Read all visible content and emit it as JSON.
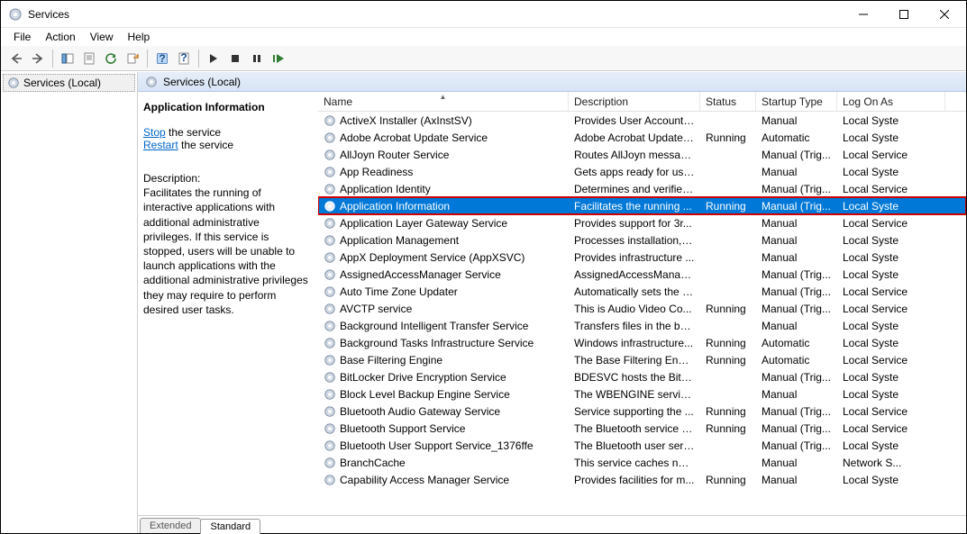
{
  "window": {
    "title": "Services"
  },
  "menu": {
    "file": "File",
    "action": "Action",
    "view": "View",
    "help": "Help"
  },
  "tree": {
    "root": "Services (Local)"
  },
  "panel_header": "Services (Local)",
  "detail": {
    "title": "Application Information",
    "stop_link": "Stop",
    "stop_tail": " the service",
    "restart_link": "Restart",
    "restart_tail": " the service",
    "desc_label": "Description:",
    "desc_body": "Facilitates the running of interactive applications with additional administrative privileges.  If this service is stopped, users will be unable to launch applications with the additional administrative privileges they may require to perform desired user tasks."
  },
  "columns": {
    "name": "Name",
    "desc": "Description",
    "status": "Status",
    "startup": "Startup Type",
    "logon": "Log On As"
  },
  "tabs": {
    "extended": "Extended",
    "standard": "Standard"
  },
  "services": [
    {
      "name": "ActiveX Installer (AxInstSV)",
      "desc": "Provides User Account ...",
      "status": "",
      "startup": "Manual",
      "logon": "Local Syste"
    },
    {
      "name": "Adobe Acrobat Update Service",
      "desc": "Adobe Acrobat Updater...",
      "status": "Running",
      "startup": "Automatic",
      "logon": "Local Syste"
    },
    {
      "name": "AllJoyn Router Service",
      "desc": "Routes AllJoyn messag...",
      "status": "",
      "startup": "Manual (Trig...",
      "logon": "Local Service"
    },
    {
      "name": "App Readiness",
      "desc": "Gets apps ready for use ...",
      "status": "",
      "startup": "Manual",
      "logon": "Local Syste"
    },
    {
      "name": "Application Identity",
      "desc": "Determines and verifies...",
      "status": "",
      "startup": "Manual (Trig...",
      "logon": "Local Service"
    },
    {
      "name": "Application Information",
      "desc": "Facilitates the running ...",
      "status": "Running",
      "startup": "Manual (Trig...",
      "logon": "Local Syste",
      "selected": true
    },
    {
      "name": "Application Layer Gateway Service",
      "desc": "Provides support for 3r...",
      "status": "",
      "startup": "Manual",
      "logon": "Local Service"
    },
    {
      "name": "Application Management",
      "desc": "Processes installation, r...",
      "status": "",
      "startup": "Manual",
      "logon": "Local Syste"
    },
    {
      "name": "AppX Deployment Service (AppXSVC)",
      "desc": "Provides infrastructure ...",
      "status": "",
      "startup": "Manual",
      "logon": "Local Syste"
    },
    {
      "name": "AssignedAccessManager Service",
      "desc": "AssignedAccessManag...",
      "status": "",
      "startup": "Manual (Trig...",
      "logon": "Local Syste"
    },
    {
      "name": "Auto Time Zone Updater",
      "desc": "Automatically sets the s...",
      "status": "",
      "startup": "Manual (Trig...",
      "logon": "Local Service"
    },
    {
      "name": "AVCTP service",
      "desc": "This is Audio Video Co...",
      "status": "Running",
      "startup": "Manual (Trig...",
      "logon": "Local Service"
    },
    {
      "name": "Background Intelligent Transfer Service",
      "desc": "Transfers files in the ba...",
      "status": "",
      "startup": "Manual",
      "logon": "Local Syste"
    },
    {
      "name": "Background Tasks Infrastructure Service",
      "desc": "Windows infrastructure...",
      "status": "Running",
      "startup": "Automatic",
      "logon": "Local Syste"
    },
    {
      "name": "Base Filtering Engine",
      "desc": "The Base Filtering Engi...",
      "status": "Running",
      "startup": "Automatic",
      "logon": "Local Service"
    },
    {
      "name": "BitLocker Drive Encryption Service",
      "desc": "BDESVC hosts the BitLo...",
      "status": "",
      "startup": "Manual (Trig...",
      "logon": "Local Syste"
    },
    {
      "name": "Block Level Backup Engine Service",
      "desc": "The WBENGINE service ...",
      "status": "",
      "startup": "Manual",
      "logon": "Local Syste"
    },
    {
      "name": "Bluetooth Audio Gateway Service",
      "desc": "Service supporting the ...",
      "status": "Running",
      "startup": "Manual (Trig...",
      "logon": "Local Service"
    },
    {
      "name": "Bluetooth Support Service",
      "desc": "The Bluetooth service s...",
      "status": "Running",
      "startup": "Manual (Trig...",
      "logon": "Local Service"
    },
    {
      "name": "Bluetooth User Support Service_1376ffe",
      "desc": "The Bluetooth user serv...",
      "status": "",
      "startup": "Manual (Trig...",
      "logon": "Local Syste"
    },
    {
      "name": "BranchCache",
      "desc": "This service caches net...",
      "status": "",
      "startup": "Manual",
      "logon": "Network S..."
    },
    {
      "name": "Capability Access Manager Service",
      "desc": "Provides facilities for m...",
      "status": "Running",
      "startup": "Manual",
      "logon": "Local Syste"
    }
  ]
}
